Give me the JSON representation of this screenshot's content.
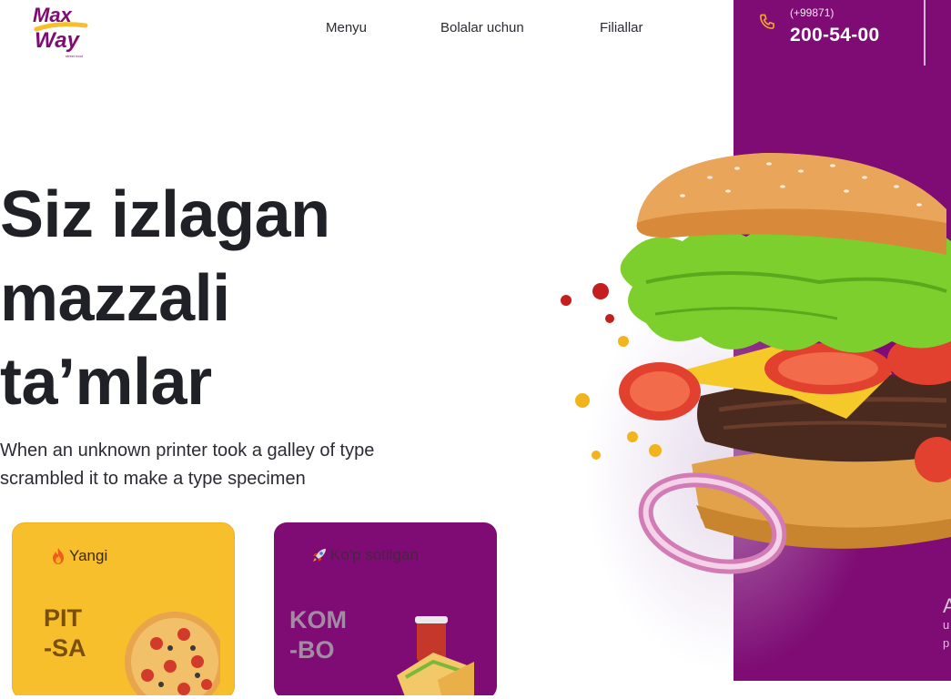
{
  "header": {
    "logo_alt": "Max Way",
    "nav": {
      "menu": "Menyu",
      "kids": "Bolalar uchun",
      "branches": "Filiallar"
    },
    "phone": {
      "code": "(+99871)",
      "number": "200-54-00",
      "icon": "phone-icon"
    }
  },
  "hero": {
    "title_line1": "Siz izlagan",
    "title_line2": "mazzali",
    "title_line3": "ta’mlar",
    "subtitle": "When an unknown printer took a galley of type scrambled it to make a type specimen"
  },
  "cards": {
    "new": {
      "badge": "Yangi",
      "badge_icon": "fire-icon",
      "title": "PIT\n-SA"
    },
    "best": {
      "badge": "Ko'p sotilgan",
      "badge_icon": "rocket-icon",
      "title": "KOM\n-BO"
    }
  },
  "side": {
    "big": "A",
    "small1": "u",
    "small2": "p"
  },
  "colors": {
    "brand_purple": "#7e0c74",
    "brand_yellow": "#f8bf2c",
    "text_dark": "#1f2127"
  }
}
